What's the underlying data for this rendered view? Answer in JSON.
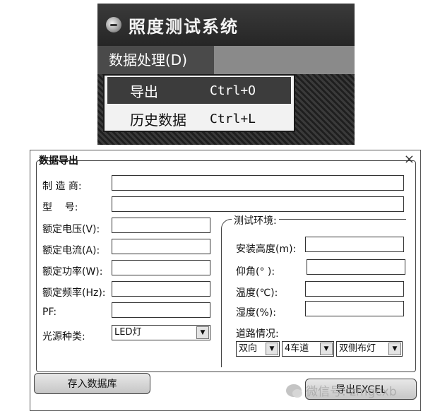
{
  "app": {
    "title": "照度测试系统",
    "menu": {
      "data_processing": "数据处理(D)"
    },
    "dropdown": [
      {
        "label": "导出",
        "shortcut": "Ctrl+O"
      },
      {
        "label": "历史数据",
        "shortcut": "Ctrl+L"
      }
    ]
  },
  "dialog": {
    "title": "数据导出",
    "close": "×",
    "fields": {
      "manufacturer": "制 造 商:",
      "model": "型    号:",
      "rated_voltage": "额定电压(V):",
      "rated_current": "额定电流(A):",
      "rated_power": "额定功率(W):",
      "rated_frequency": "额定频率(Hz):",
      "pf": "PF:",
      "light_source": "光源种类:"
    },
    "light_source_value": "LED灯",
    "env": {
      "title": "测试环境:",
      "install_height": "安装高度(m):",
      "elevation": "仰角(° ):",
      "temperature": "温度(℃):",
      "humidity": "湿度(%):",
      "road": "道路情况:",
      "road_dir": "双向",
      "lanes": "4车道",
      "lamp_layout": "双侧布灯"
    },
    "buttons": {
      "save_db": "存入数据库",
      "export_excel": "导出EXCEL"
    }
  },
  "watermark": "微信号: zmgcxb"
}
